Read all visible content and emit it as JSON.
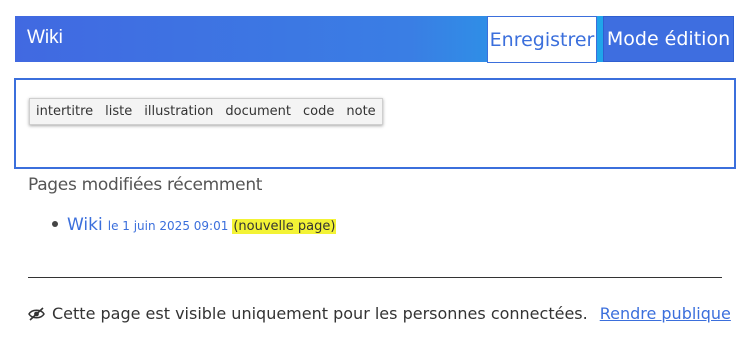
{
  "header": {
    "title": "Wiki",
    "save_label": "Enregistrer",
    "mode_label": "Mode édition"
  },
  "toolbar": {
    "items": [
      "intertitre",
      "liste",
      "illustration",
      "document",
      "code",
      "note"
    ]
  },
  "recent": {
    "title": "Pages modifiées récemment",
    "items": [
      {
        "link": "Wiki",
        "date": "le 1 juin 2025 09:01",
        "badge": "(nouvelle page)"
      }
    ]
  },
  "visibility": {
    "icon": "eye-slash-icon",
    "text": "Cette page est visible uniquement pour les personnes connectées.",
    "link": "Rendre publique"
  },
  "colors": {
    "accent": "#3b6fdc",
    "header_gradient_start": "#4169e1",
    "header_gradient_end": "#1fa6ea",
    "badge": "#f3f335"
  }
}
